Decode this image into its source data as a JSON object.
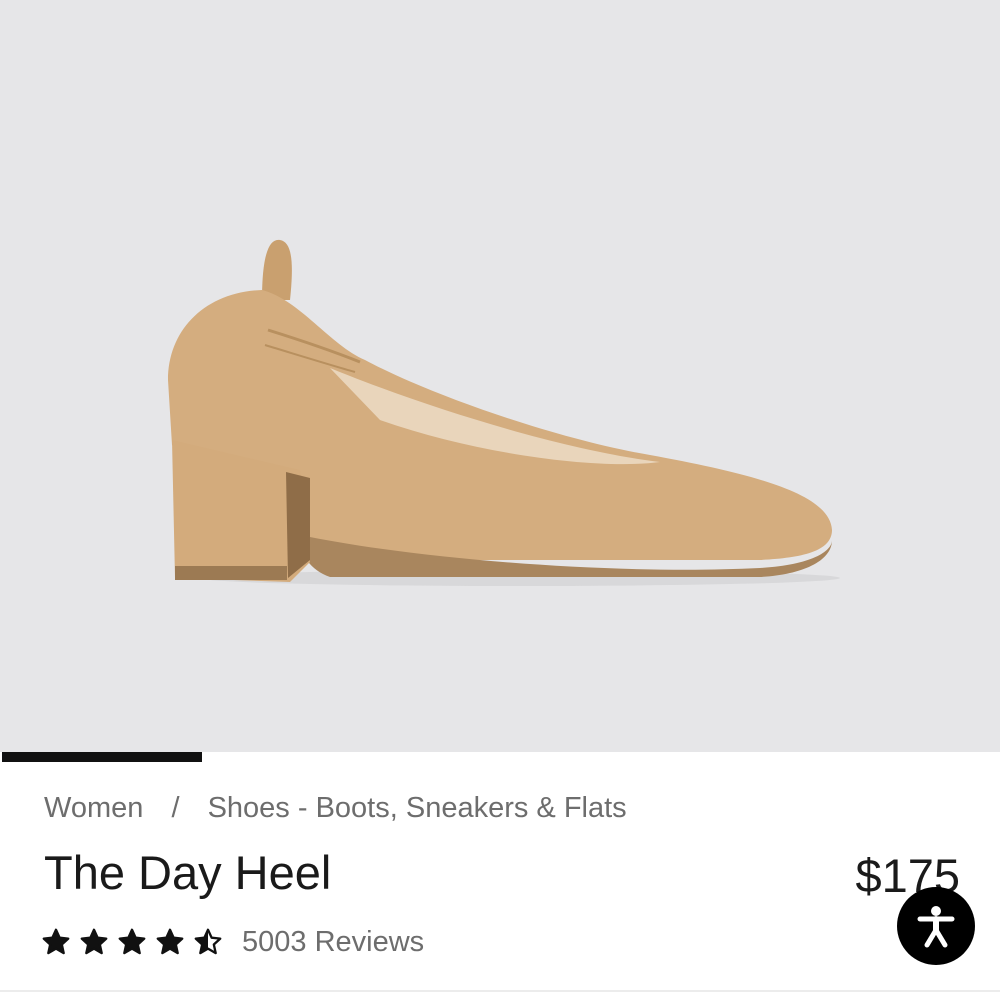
{
  "gallery": {
    "image_subject": "shoe-image",
    "progress_fraction": 0.2
  },
  "breadcrumb": {
    "items": [
      "Women",
      "Shoes - Boots, Sneakers & Flats"
    ],
    "separator": "/"
  },
  "product": {
    "title": "The Day Heel",
    "price": "$175",
    "rating": 4.5,
    "rating_max": 5,
    "reviews_label": "5003 Reviews"
  },
  "accessibility": {
    "icon": "accessibility-icon"
  },
  "colors": {
    "gallery_background": "#e6e6e8",
    "shoe": "#d3ab7c",
    "accent": "#111111"
  }
}
